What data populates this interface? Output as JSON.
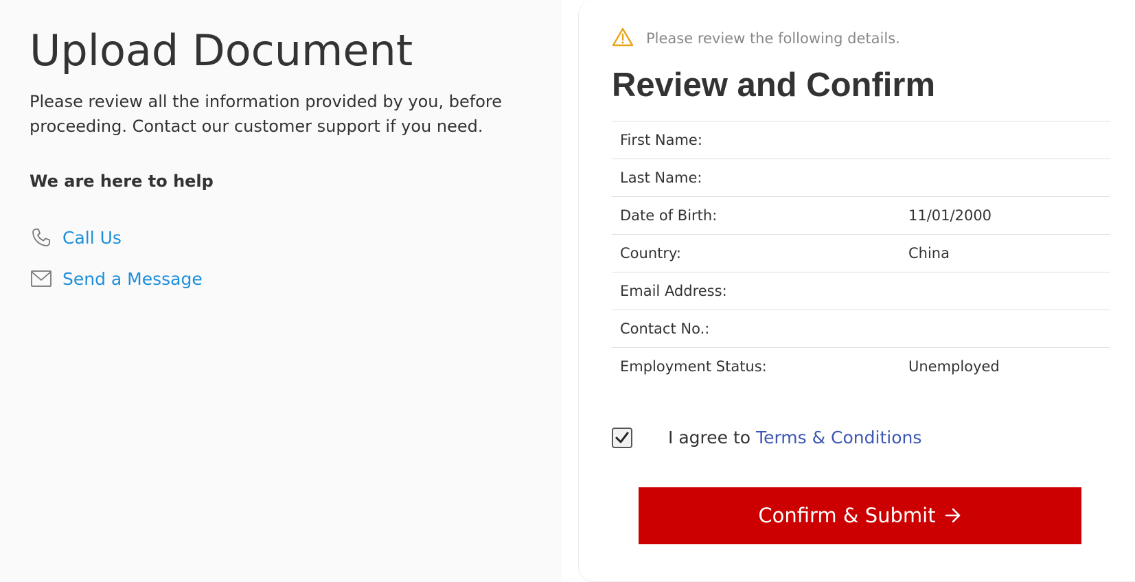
{
  "left": {
    "title": "Upload Document",
    "intro": "Please review all the information provided by you, before proceeding. Contact our customer support if you need.",
    "help_heading": "We are here to help",
    "contacts": [
      {
        "icon": "phone-icon",
        "label": "Call Us"
      },
      {
        "icon": "envelope-icon",
        "label": "Send a Message"
      }
    ]
  },
  "right": {
    "notice_icon": "warning-icon",
    "notice_text": "Please review the following details.",
    "title": "Review and Confirm",
    "details": [
      {
        "label": "First Name:",
        "value": ""
      },
      {
        "label": "Last Name:",
        "value": ""
      },
      {
        "label": "Date of Birth:",
        "value": "11/01/2000"
      },
      {
        "label": "Country:",
        "value": "China"
      },
      {
        "label": "Email Address:",
        "value": ""
      },
      {
        "label": "Contact No.:",
        "value": ""
      },
      {
        "label": "Employment Status:",
        "value": "Unemployed"
      }
    ],
    "agree_checked": true,
    "agree_text": "I agree to",
    "terms_link": "Terms & Conditions",
    "submit_label": "Confirm & Submit"
  },
  "colors": {
    "link": "#1e8fdb",
    "terms_link": "#3d57b5",
    "submit_bg": "#cc0000",
    "warning": "#e8a317",
    "left_bg": "#fafafa"
  }
}
